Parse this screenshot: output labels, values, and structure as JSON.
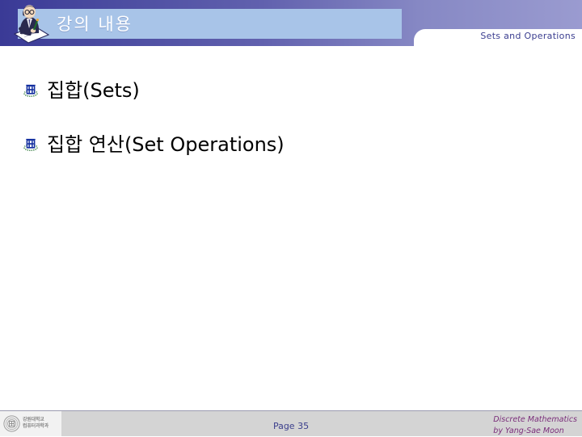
{
  "slide": {
    "title": "강의 내용",
    "subtitle": "Sets and Operations",
    "title_icon": "writer-at-desk-icon",
    "bullets": [
      {
        "icon": "university-emblem-bullet-icon",
        "text": "집합(Sets)"
      },
      {
        "icon": "university-emblem-bullet-icon",
        "text": "집합 연산(Set Operations)"
      }
    ]
  },
  "footer": {
    "logo_icon": "university-seal-icon",
    "logo_line1": "강원대학교",
    "logo_line2": "컴퓨터과학과",
    "page_label": "Page 35",
    "credit_line1": "Discrete Mathematics",
    "credit_line2": "by Yang-Sae Moon"
  },
  "colors": {
    "header_gradient_start": "#3a3a96",
    "header_gradient_end": "#9a9bd0",
    "header_band": "#a8c4e8",
    "subtitle": "#3a3d8f",
    "page_number": "#3b3f8c",
    "credit": "#7a2d7a",
    "footer_bar": "#d4d4d4",
    "bullet_text": "#000000"
  }
}
